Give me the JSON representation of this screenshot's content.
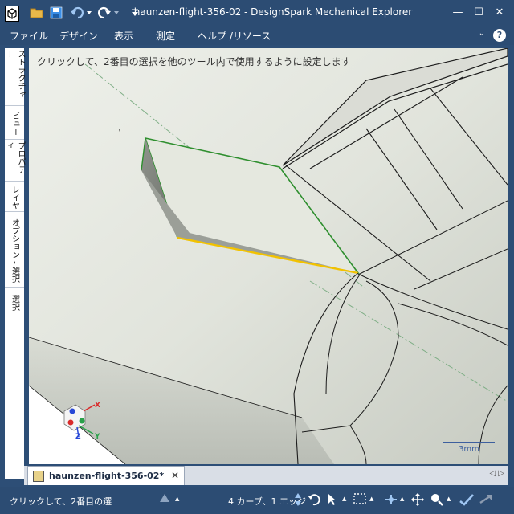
{
  "window": {
    "title": "haunzen-flight-356-02 - DesignSpark Mechanical Explorer",
    "minimize_label": "—",
    "maximize_label": "☐",
    "close_label": "✕"
  },
  "quick_access": {
    "icons": [
      "app-icon",
      "open-folder-icon",
      "save-icon",
      "undo-icon",
      "redo-icon",
      "customize-icon"
    ]
  },
  "menu": {
    "items": [
      "ファイル",
      "デザイン",
      "表示",
      "測定",
      "ヘルプ /リソース"
    ],
    "help_label": "?",
    "collapse_label": "⌄"
  },
  "side_tabs": [
    "ストラクチャー",
    "ビュー",
    "プロパティ",
    "レイヤ",
    "オプション - 選択",
    "選択"
  ],
  "viewport": {
    "hint": "クリックして、2番目の選択を他のツール内で使用するように設定します",
    "scale_label": "3mm",
    "triad_labels": [
      "X",
      "Y",
      "Z"
    ],
    "colors": {
      "background": "#e3e5de",
      "selection_green": "#2f8f2f",
      "selection_yellow": "#f2c200",
      "edge": "#1c1c1c",
      "axis_dashdot": "#7fae86"
    }
  },
  "document_tabs": [
    {
      "label": "haunzen-flight-356-02*",
      "close_label": "✕"
    }
  ],
  "tab_nav_label": "◁ ▷",
  "status": {
    "message": "クリックして、2番目の選",
    "selection": "4 カーブ、1 エッジ",
    "icons": [
      "up-triangle-icon",
      "select-history-icon",
      "pointer-icon",
      "box-select-icon",
      "move-icon",
      "pan-icon",
      "zoom-icon",
      "check-icon",
      "redo-gray-icon"
    ]
  }
}
